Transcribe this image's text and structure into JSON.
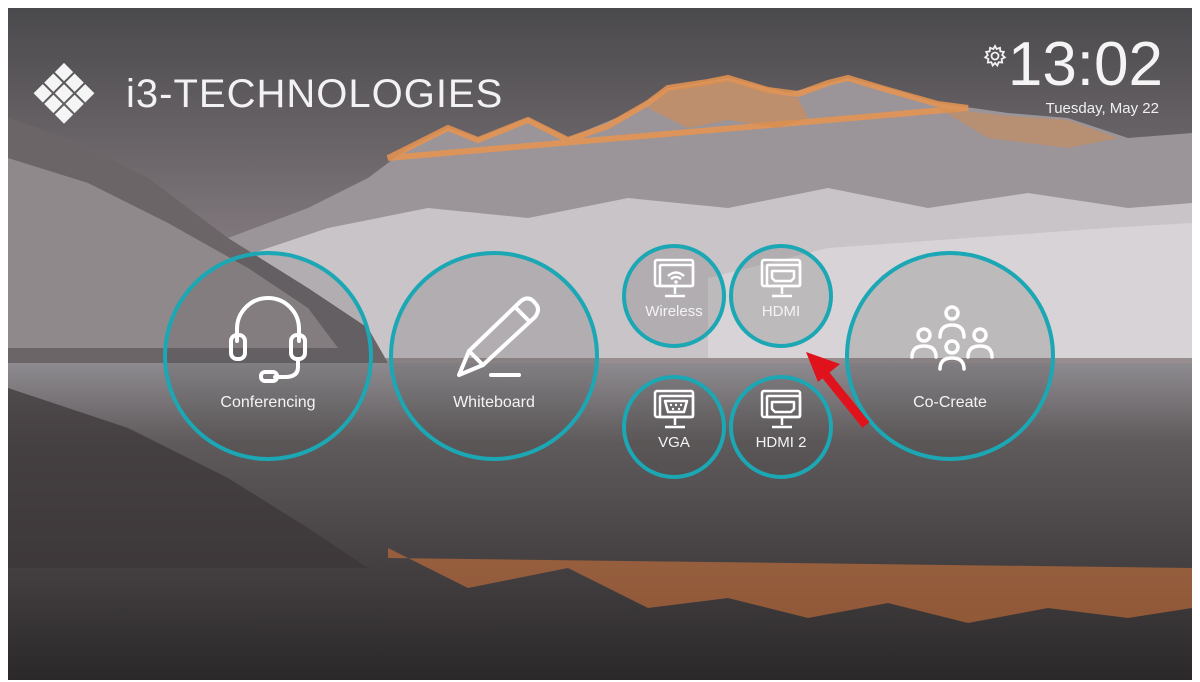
{
  "branding": {
    "name": "i3-TECHNOLOGIES",
    "logo": "diamond-grid-logo"
  },
  "status": {
    "time": "13:02",
    "date": "Tuesday, May 22",
    "settings_icon": "gear-icon"
  },
  "tiles": {
    "conferencing": {
      "label": "Conferencing",
      "icon": "headset-icon"
    },
    "whiteboard": {
      "label": "Whiteboard",
      "icon": "pencil-icon"
    },
    "wireless": {
      "label": "Wireless",
      "icon": "wireless-monitor-icon"
    },
    "hdmi": {
      "label": "HDMI",
      "icon": "hdmi-monitor-icon"
    },
    "vga": {
      "label": "VGA",
      "icon": "vga-monitor-icon"
    },
    "hdmi2": {
      "label": "HDMI 2",
      "icon": "hdmi-monitor-icon"
    },
    "cocreate": {
      "label": "Co-Create",
      "icon": "people-group-icon"
    }
  },
  "colors": {
    "accent": "#1ba7b4",
    "annotation_arrow": "#e0121b",
    "text": "#ffffff"
  }
}
